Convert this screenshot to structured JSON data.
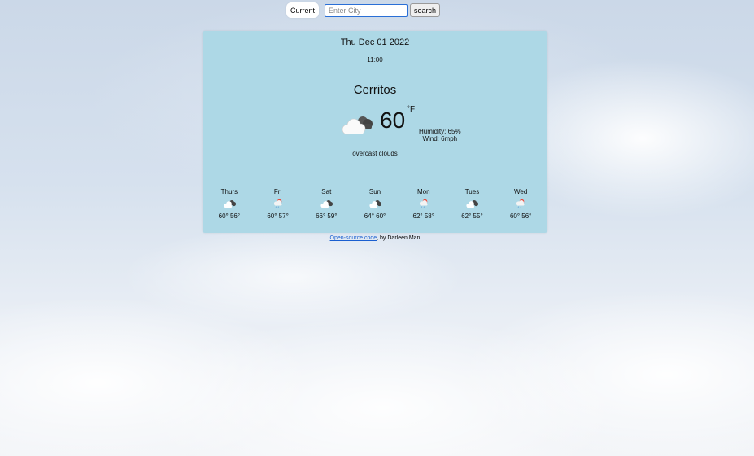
{
  "search": {
    "current_label": "Current",
    "placeholder": "Enter City",
    "search_label": "search"
  },
  "current": {
    "date": "Thu Dec 01 2022",
    "time": "11:00",
    "city": "Cerritos",
    "temperature": "60",
    "unit": "°F",
    "humidity": "Humidity: 65%",
    "wind": "Wind: 6mph",
    "description": "overcast clouds",
    "icon": "broken-clouds-icon"
  },
  "forecast": [
    {
      "day": "Thurs",
      "temps": "60° 56°",
      "icon": "broken-clouds-icon"
    },
    {
      "day": "Fri",
      "temps": "60° 57°",
      "icon": "rain-icon"
    },
    {
      "day": "Sat",
      "temps": "66° 59°",
      "icon": "broken-clouds-icon"
    },
    {
      "day": "Sun",
      "temps": "64° 60°",
      "icon": "broken-clouds-icon"
    },
    {
      "day": "Mon",
      "temps": "62° 58°",
      "icon": "rain-icon"
    },
    {
      "day": "Tues",
      "temps": "62° 55°",
      "icon": "broken-clouds-icon"
    },
    {
      "day": "Wed",
      "temps": "60° 56°",
      "icon": "rain-icon"
    }
  ],
  "footer": {
    "link_text": "Open-source code",
    "text": ", by Darleen Man"
  },
  "colors": {
    "card": "#add8e6",
    "link": "#1a5fd0"
  }
}
